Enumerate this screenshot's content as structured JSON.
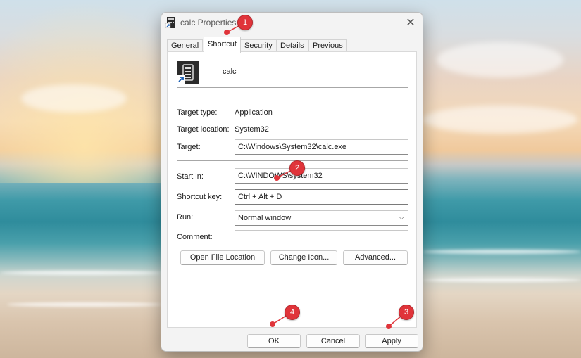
{
  "window": {
    "title": "calc Properties",
    "close_icon": "close-icon"
  },
  "tabs": [
    {
      "label": "General"
    },
    {
      "label": "Shortcut",
      "active": true
    },
    {
      "label": "Security"
    },
    {
      "label": "Details"
    },
    {
      "label": "Previous Versions"
    }
  ],
  "shortcut": {
    "name": "calc",
    "target_type_label": "Target type:",
    "target_type": "Application",
    "target_location_label": "Target location:",
    "target_location": "System32",
    "target_label": "Target:",
    "target": "C:\\Windows\\System32\\calc.exe",
    "start_in_label": "Start in:",
    "start_in": "C:\\WINDOWS\\system32",
    "shortcut_key_label": "Shortcut key:",
    "shortcut_key": "Ctrl + Alt + D",
    "run_label": "Run:",
    "run": "Normal window",
    "comment_label": "Comment:",
    "comment": ""
  },
  "buttons": {
    "open_file_location": "Open File Location",
    "change_icon": "Change Icon...",
    "advanced": "Advanced...",
    "ok": "OK",
    "cancel": "Cancel",
    "apply": "Apply"
  },
  "annotations": [
    "1",
    "2",
    "3",
    "4"
  ],
  "colors": {
    "marker": "#e0343a",
    "window_bg": "#f3f3f3"
  }
}
